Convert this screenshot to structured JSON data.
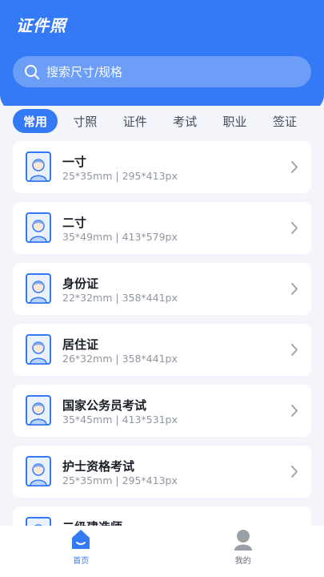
{
  "header": {
    "title": "证件照"
  },
  "search": {
    "placeholder": "搜索尺寸/规格",
    "icon": "search-icon"
  },
  "tabs": [
    {
      "label": "常用",
      "active": true
    },
    {
      "label": "寸照",
      "active": false
    },
    {
      "label": "证件",
      "active": false
    },
    {
      "label": "考试",
      "active": false
    },
    {
      "label": "职业",
      "active": false
    },
    {
      "label": "签证",
      "active": false
    }
  ],
  "items": [
    {
      "title": "一寸",
      "spec": "25*35mm | 295*413px"
    },
    {
      "title": "二寸",
      "spec": "35*49mm | 413*579px"
    },
    {
      "title": "身份证",
      "spec": "22*32mm | 358*441px"
    },
    {
      "title": "居住证",
      "spec": "26*32mm | 358*441px"
    },
    {
      "title": "国家公务员考试",
      "spec": "35*45mm | 413*531px"
    },
    {
      "title": "护士资格考试",
      "spec": "25*35mm | 295*413px"
    },
    {
      "title": "二级建造师",
      "spec": ""
    }
  ],
  "bottom_nav": [
    {
      "label": "首页",
      "icon": "home-icon",
      "active": true
    },
    {
      "label": "我的",
      "icon": "profile-icon",
      "active": false
    }
  ],
  "colors": {
    "primary": "#3479f6",
    "background": "#f3f5fa"
  }
}
